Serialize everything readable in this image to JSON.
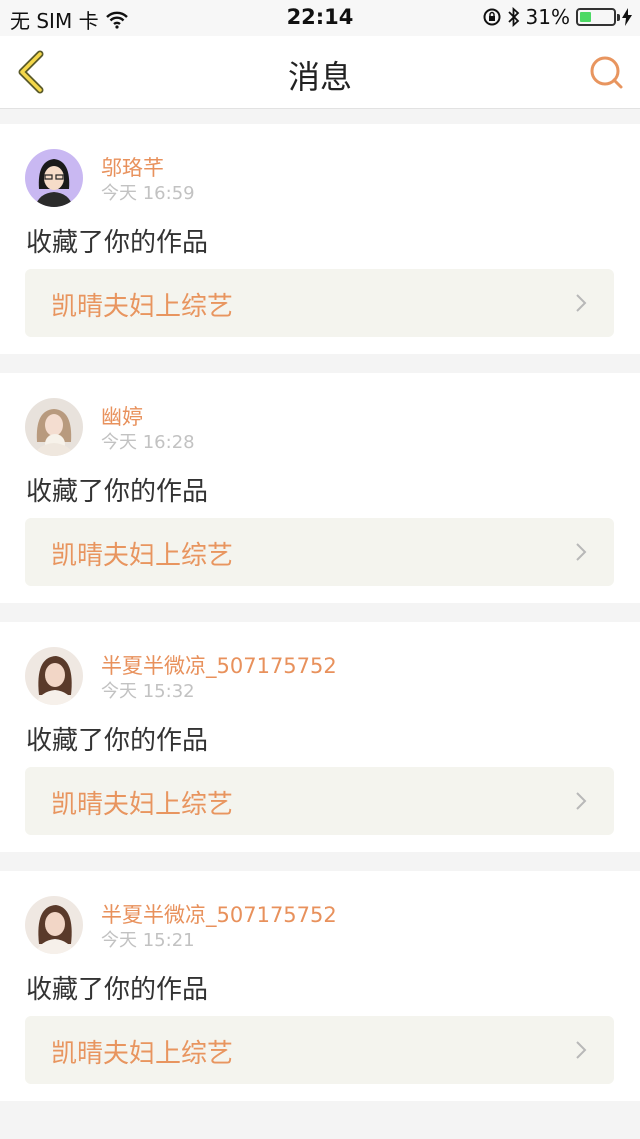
{
  "status_bar": {
    "carrier": "无 SIM 卡",
    "time": "22:14",
    "battery_percent": "31%",
    "battery_level": 0.31
  },
  "nav": {
    "title": "消息",
    "back_icon": "chevron-left-icon",
    "search_icon": "search-icon",
    "accent": "#e8955f"
  },
  "messages": [
    {
      "name": "邬珞芊",
      "time": "今天 16:59",
      "action": "收藏了你的作品",
      "work": "凯晴夫妇上综艺"
    },
    {
      "name": "幽婷",
      "time": "今天 16:28",
      "action": "收藏了你的作品",
      "work": "凯晴夫妇上综艺"
    },
    {
      "name": "半夏半微凉_507175752",
      "time": "今天 15:32",
      "action": "收藏了你的作品",
      "work": "凯晴夫妇上综艺"
    },
    {
      "name": "半夏半微凉_507175752",
      "time": "今天 15:21",
      "action": "收藏了你的作品",
      "work": "凯晴夫妇上综艺"
    }
  ]
}
